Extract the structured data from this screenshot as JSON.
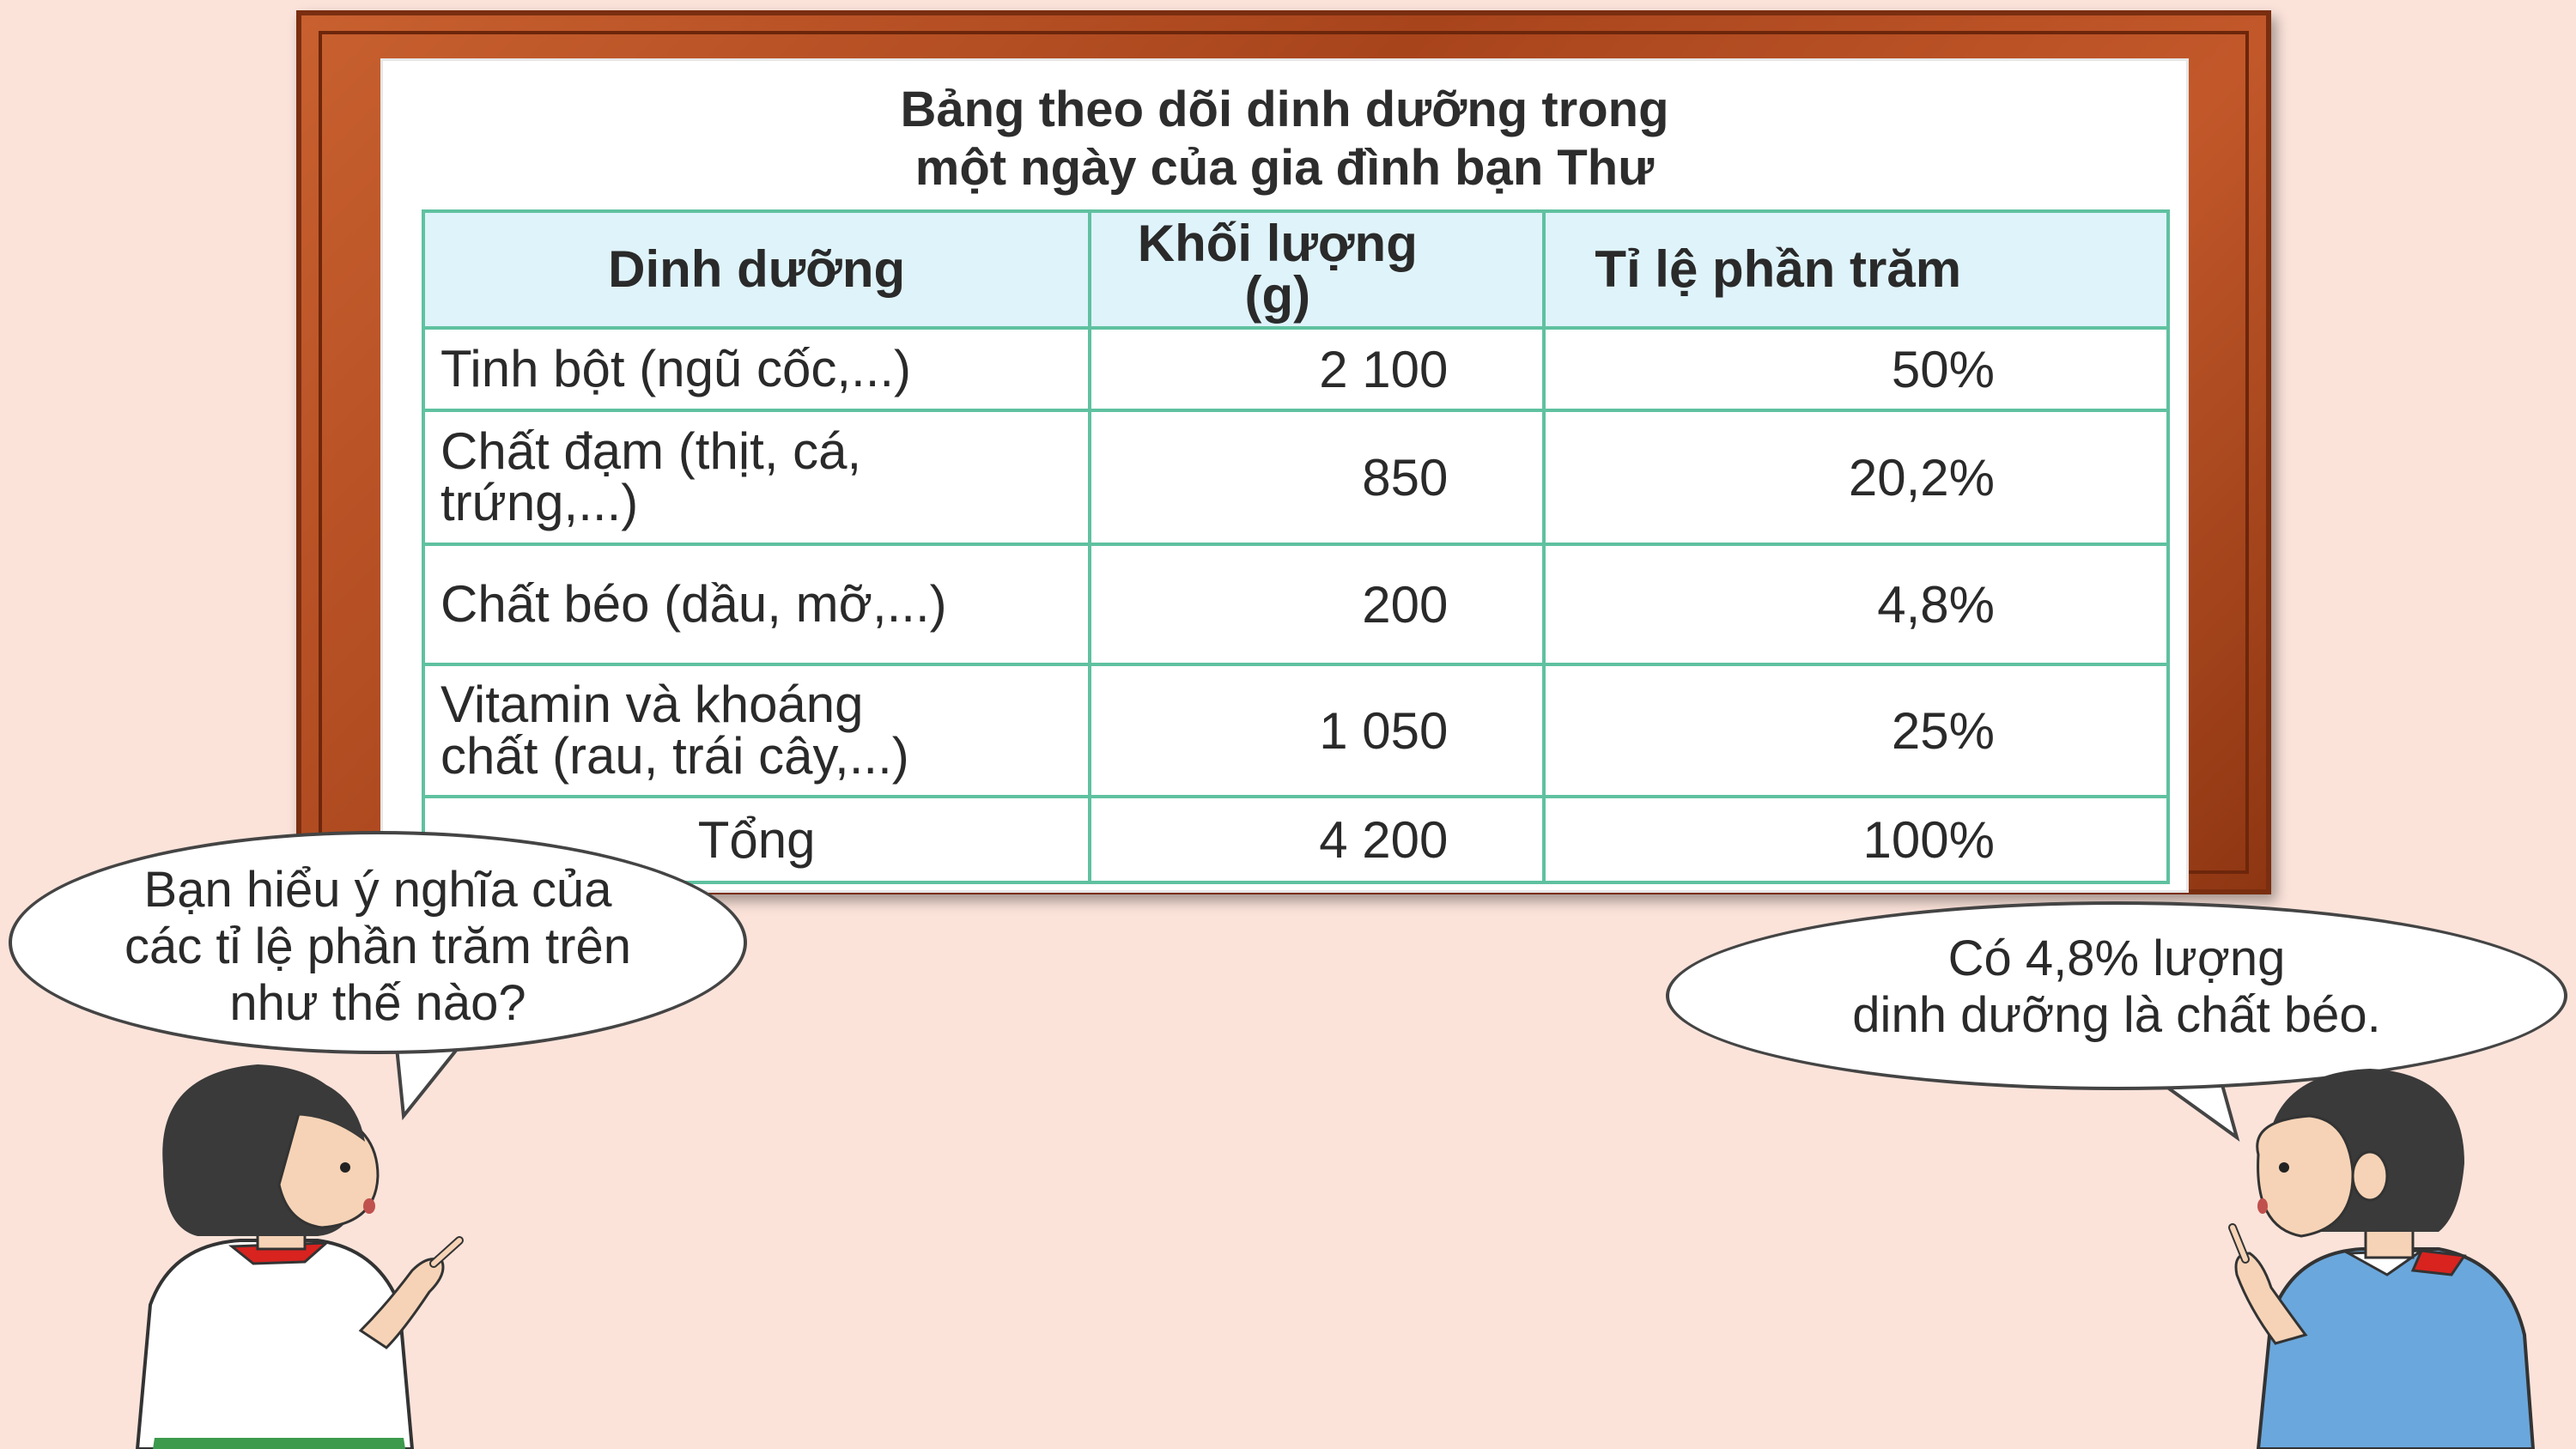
{
  "board": {
    "title_line1": "Bảng theo dõi dinh dưỡng trong",
    "title_line2": "một ngày của gia đình bạn Thư"
  },
  "table": {
    "headers": {
      "nutrient": "Dinh dưỡng",
      "mass_line1": "Khối lượng",
      "mass_line2": "(g)",
      "percent": "Tỉ lệ phần trăm"
    },
    "rows": [
      {
        "name_line1": "Tinh bột (ngũ cốc,...)",
        "name_line2": "",
        "mass": "2 100",
        "percent": "50%"
      },
      {
        "name_line1": "Chất đạm (thịt, cá,",
        "name_line2": "trứng,...)",
        "mass": "850",
        "percent": "20,2%"
      },
      {
        "name_line1": "Chất béo (dầu, mỡ,...)",
        "name_line2": "",
        "mass": "200",
        "percent": "4,8%"
      },
      {
        "name_line1": "Vitamin và khoáng",
        "name_line2": "chất (rau, trái cây,...)",
        "mass": "1 050",
        "percent": "25%"
      }
    ],
    "total": {
      "name": "Tổng",
      "mass": "4 200",
      "percent": "100%"
    }
  },
  "bubbles": {
    "left": {
      "line1": "Bạn hiểu ý nghĩa của",
      "line2": "các tỉ lệ phần trăm trên",
      "line3": "như thế nào?"
    },
    "right": {
      "line1": "Có 4,8% lượng",
      "line2": "dinh dưỡng là chất béo."
    }
  },
  "colors": {
    "background": "#fbe3da",
    "frame": "#b24a20",
    "table_border": "#5fc1a0",
    "header_fill": "#dff3fa",
    "scarf": "#d8231f",
    "boy_shirt": "#6aa7dc"
  }
}
